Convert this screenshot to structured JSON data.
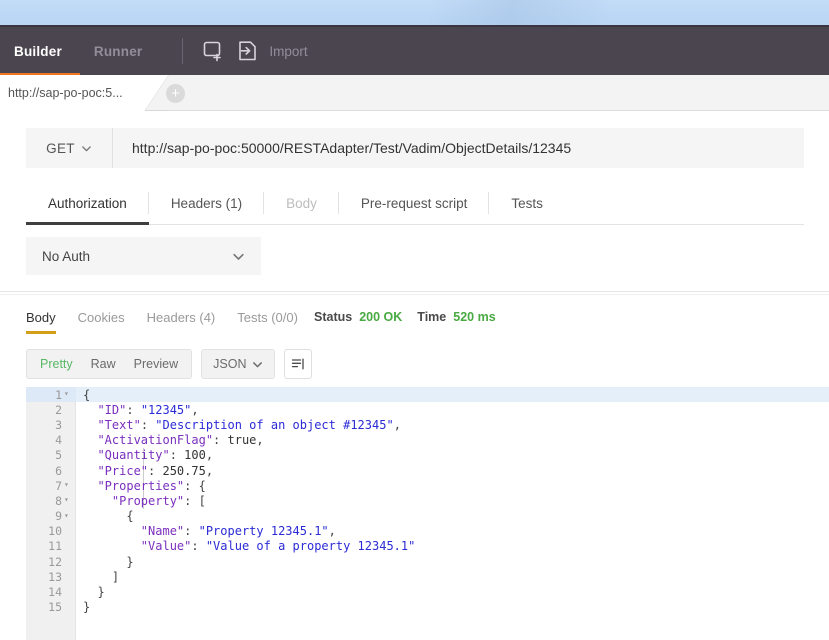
{
  "toolbar": {
    "builder_label": "Builder",
    "runner_label": "Runner",
    "new_tab_icon": "new-tab-icon",
    "import_icon": "import-icon",
    "import_label": "Import",
    "accent_color": "#f1761f",
    "background_color": "#4b454f"
  },
  "tabbar": {
    "request_tab_label": "http://sap-po-poc:5...",
    "add_tab_label": "+"
  },
  "request": {
    "method": "GET",
    "method_chevron": "chevron-down-icon",
    "url": "http://sap-po-poc:50000/RESTAdapter/Test/Vadim/ObjectDetails/12345",
    "tabs": [
      {
        "label": "Authorization",
        "state": "active"
      },
      {
        "label": "Headers (1)",
        "state": "normal"
      },
      {
        "label": "Body",
        "state": "disabled"
      },
      {
        "label": "Pre-request script",
        "state": "normal"
      },
      {
        "label": "Tests",
        "state": "normal"
      }
    ],
    "auth": {
      "selected": "No Auth",
      "chevron": "chevron-down-icon"
    }
  },
  "response": {
    "tabs": [
      {
        "label": "Body",
        "state": "active"
      },
      {
        "label": "Cookies",
        "state": "normal"
      },
      {
        "label": "Headers (4)",
        "state": "normal"
      },
      {
        "label": "Tests (0/0)",
        "state": "normal"
      }
    ],
    "status_label": "Status",
    "status_value": "200 OK",
    "time_label": "Time",
    "time_value": "520 ms",
    "status_color": "#49a942",
    "format": {
      "pretty": "Pretty",
      "raw": "Raw",
      "preview": "Preview",
      "active": "Pretty",
      "active_color": "#59b866",
      "language": "JSON",
      "language_chevron": "chevron-down-icon",
      "wrap_icon": "word-wrap-icon"
    },
    "body_lines": [
      {
        "num": "1",
        "fold": "▾",
        "highlight": true,
        "indent": 0,
        "parts": [
          {
            "t": "{",
            "c": "p"
          }
        ]
      },
      {
        "num": "2",
        "fold": "",
        "highlight": false,
        "indent": 1,
        "parts": [
          {
            "t": "\"ID\"",
            "c": "k"
          },
          {
            "t": ": ",
            "c": "p"
          },
          {
            "t": "\"12345\"",
            "c": "s"
          },
          {
            "t": ",",
            "c": "p"
          }
        ]
      },
      {
        "num": "3",
        "fold": "",
        "highlight": false,
        "indent": 1,
        "parts": [
          {
            "t": "\"Text\"",
            "c": "k"
          },
          {
            "t": ": ",
            "c": "p"
          },
          {
            "t": "\"Description of an object #12345\"",
            "c": "s"
          },
          {
            "t": ",",
            "c": "p"
          }
        ]
      },
      {
        "num": "4",
        "fold": "",
        "highlight": false,
        "indent": 1,
        "parts": [
          {
            "t": "\"ActivationFlag\"",
            "c": "k"
          },
          {
            "t": ": ",
            "c": "p"
          },
          {
            "t": "true",
            "c": "n"
          },
          {
            "t": ",",
            "c": "p"
          }
        ]
      },
      {
        "num": "5",
        "fold": "",
        "highlight": false,
        "indent": 1,
        "parts": [
          {
            "t": "\"Quantity\"",
            "c": "k"
          },
          {
            "t": ": ",
            "c": "p"
          },
          {
            "t": "100",
            "c": "n"
          },
          {
            "t": ",",
            "c": "p"
          }
        ]
      },
      {
        "num": "6",
        "fold": "",
        "highlight": false,
        "indent": 1,
        "parts": [
          {
            "t": "\"Price\"",
            "c": "k"
          },
          {
            "t": ": ",
            "c": "p"
          },
          {
            "t": "250.75",
            "c": "n"
          },
          {
            "t": ",",
            "c": "p"
          }
        ]
      },
      {
        "num": "7",
        "fold": "▾",
        "highlight": false,
        "indent": 1,
        "parts": [
          {
            "t": "\"Properties\"",
            "c": "k"
          },
          {
            "t": ": {",
            "c": "p"
          }
        ]
      },
      {
        "num": "8",
        "fold": "▾",
        "highlight": false,
        "indent": 2,
        "parts": [
          {
            "t": "\"Property\"",
            "c": "k"
          },
          {
            "t": ": [",
            "c": "p"
          }
        ]
      },
      {
        "num": "9",
        "fold": "▾",
        "highlight": false,
        "indent": 3,
        "parts": [
          {
            "t": "{",
            "c": "p"
          }
        ]
      },
      {
        "num": "10",
        "fold": "",
        "highlight": false,
        "indent": 4,
        "parts": [
          {
            "t": "\"Name\"",
            "c": "k"
          },
          {
            "t": ": ",
            "c": "p"
          },
          {
            "t": "\"Property 12345.1\"",
            "c": "s"
          },
          {
            "t": ",",
            "c": "p"
          }
        ]
      },
      {
        "num": "11",
        "fold": "",
        "highlight": false,
        "indent": 4,
        "parts": [
          {
            "t": "\"Value\"",
            "c": "k"
          },
          {
            "t": ": ",
            "c": "p"
          },
          {
            "t": "\"Value of a property 12345.1\"",
            "c": "s"
          }
        ]
      },
      {
        "num": "12",
        "fold": "",
        "highlight": false,
        "indent": 3,
        "parts": [
          {
            "t": "}",
            "c": "p"
          }
        ]
      },
      {
        "num": "13",
        "fold": "",
        "highlight": false,
        "indent": 2,
        "parts": [
          {
            "t": "]",
            "c": "p"
          }
        ]
      },
      {
        "num": "14",
        "fold": "",
        "highlight": false,
        "indent": 1,
        "parts": [
          {
            "t": "}",
            "c": "p"
          }
        ]
      },
      {
        "num": "15",
        "fold": "",
        "highlight": false,
        "indent": 0,
        "parts": [
          {
            "t": "}",
            "c": "p"
          }
        ]
      }
    ]
  }
}
